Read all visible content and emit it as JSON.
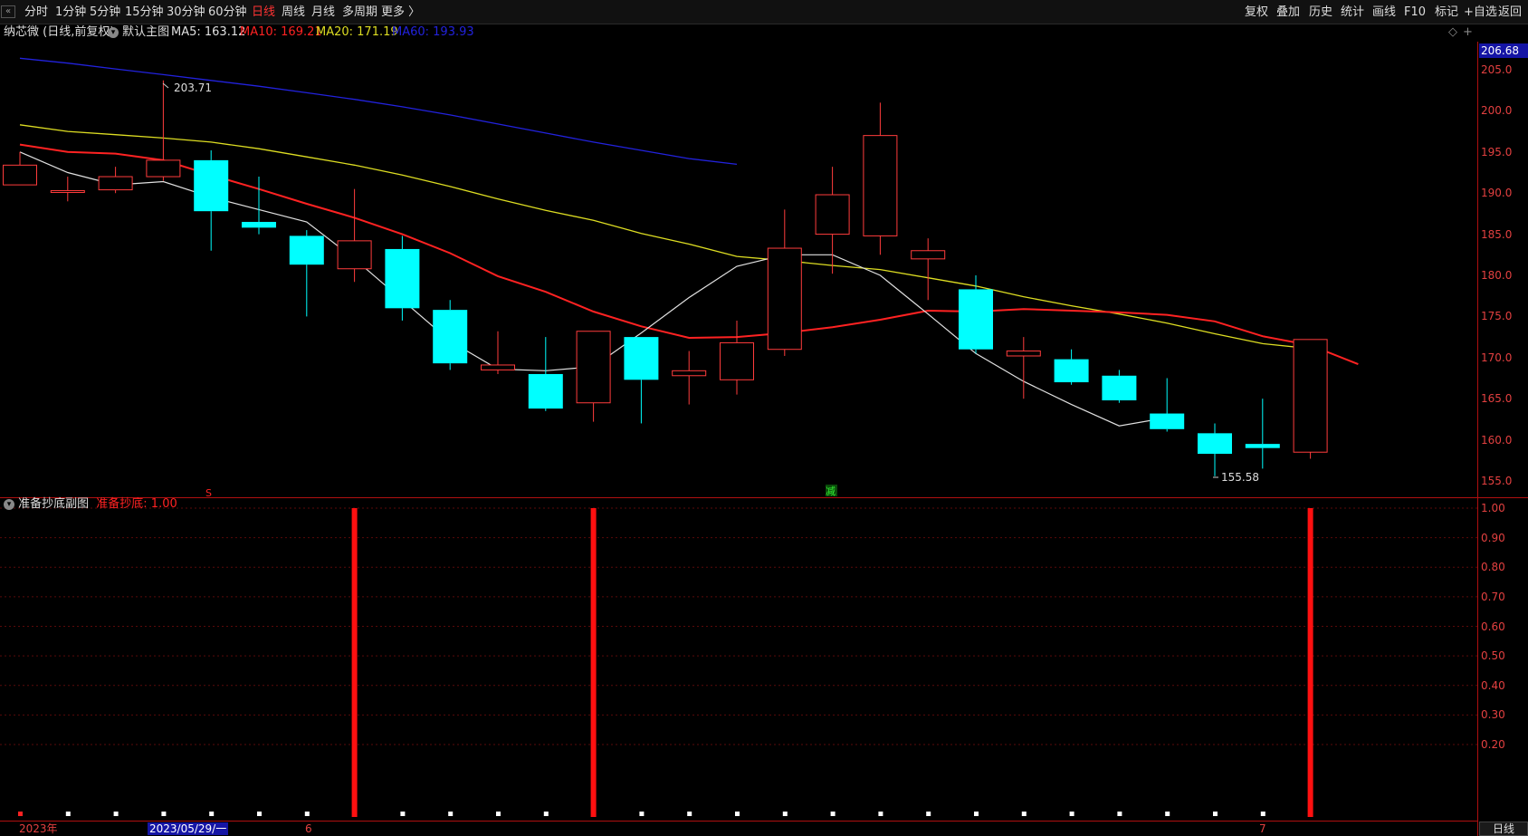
{
  "toolbar": {
    "tabs": [
      "分时",
      "1分钟",
      "5分钟",
      "15分钟",
      "30分钟",
      "60分钟",
      "日线",
      "周线",
      "月线",
      "多周期",
      "更多 〉"
    ],
    "active_tab": "日线",
    "right_buttons": [
      "复权",
      "叠加",
      "历史",
      "统计",
      "画线",
      "F10",
      "标记",
      "+自选",
      "返回"
    ]
  },
  "chart_header": {
    "stock": "纳芯微 (日线,前复权)",
    "template": "默认主图",
    "ma5": "MA5: 163.12",
    "ma10": "MA10: 169.21",
    "ma20": "MA20: 171.19",
    "ma60": "MA60: 193.93",
    "ma_colors": {
      "ma5": "#e0e0e0",
      "ma10": "#ff2222",
      "ma20": "#dddd22",
      "ma60": "#2222dd"
    }
  },
  "price_axis": {
    "last_price": "206.68",
    "ticks": [
      "205.0",
      "200.0",
      "195.0",
      "190.0",
      "185.0",
      "180.0",
      "175.0",
      "170.0",
      "165.0",
      "160.0",
      "155.0"
    ]
  },
  "annotations": {
    "high_label": "203.71",
    "low_label": "155.58",
    "mark_s": "S",
    "mark_jian": "减"
  },
  "sub_chart": {
    "title": "准备抄底副图",
    "value_label": "准备抄底: 1.00",
    "ticks": [
      "1.00",
      "0.90",
      "0.80",
      "0.70",
      "0.60",
      "0.50",
      "0.40",
      "0.30",
      "0.20"
    ]
  },
  "x_axis": {
    "year": "2023年",
    "date": "2023/05/29/一",
    "m6": "6",
    "m7": "7"
  },
  "bottom_tab": "日线",
  "chart_data": {
    "type": "candlestick",
    "price_ylim": [
      154,
      208
    ],
    "candles": [
      {
        "o": 191.0,
        "c": 193.4,
        "h": 195.0,
        "l": 191.0
      },
      {
        "o": 190.2,
        "c": 190.3,
        "h": 192.0,
        "l": 189.0
      },
      {
        "o": 190.4,
        "c": 192.0,
        "h": 193.2,
        "l": 190.0
      },
      {
        "o": 192.0,
        "c": 194.0,
        "h": 203.71,
        "l": 191.5
      },
      {
        "o": 194.0,
        "c": 187.8,
        "h": 195.2,
        "l": 183.0
      },
      {
        "o": 186.5,
        "c": 185.8,
        "h": 192.0,
        "l": 185.0
      },
      {
        "o": 184.8,
        "c": 181.3,
        "h": 185.5,
        "l": 175.0
      },
      {
        "o": 180.8,
        "c": 184.2,
        "h": 190.5,
        "l": 179.2
      },
      {
        "o": 183.2,
        "c": 176.0,
        "h": 184.8,
        "l": 174.5
      },
      {
        "o": 175.8,
        "c": 169.3,
        "h": 177.0,
        "l": 168.5
      },
      {
        "o": 168.5,
        "c": 169.1,
        "h": 173.2,
        "l": 168.0
      },
      {
        "o": 168.0,
        "c": 163.8,
        "h": 172.5,
        "l": 163.5
      },
      {
        "o": 164.5,
        "c": 173.2,
        "h": 173.2,
        "l": 162.2
      },
      {
        "o": 172.5,
        "c": 167.3,
        "h": 172.5,
        "l": 162.0
      },
      {
        "o": 167.8,
        "c": 168.4,
        "h": 170.8,
        "l": 164.3
      },
      {
        "o": 167.3,
        "c": 171.8,
        "h": 174.5,
        "l": 165.5
      },
      {
        "o": 171.0,
        "c": 183.3,
        "h": 188.0,
        "l": 170.2
      },
      {
        "o": 185.0,
        "c": 189.8,
        "h": 193.2,
        "l": 180.2
      },
      {
        "o": 184.8,
        "c": 197.0,
        "h": 201.0,
        "l": 182.5
      },
      {
        "o": 182.0,
        "c": 183.0,
        "h": 184.5,
        "l": 177.0
      },
      {
        "o": 178.3,
        "c": 171.0,
        "h": 180.0,
        "l": 170.5
      },
      {
        "o": 170.2,
        "c": 170.8,
        "h": 172.5,
        "l": 165.0
      },
      {
        "o": 169.8,
        "c": 167.0,
        "h": 171.0,
        "l": 166.7
      },
      {
        "o": 167.8,
        "c": 164.8,
        "h": 168.5,
        "l": 164.5
      },
      {
        "o": 163.2,
        "c": 161.3,
        "h": 167.5,
        "l": 161.0
      },
      {
        "o": 160.8,
        "c": 158.3,
        "h": 162.0,
        "l": 155.58
      },
      {
        "o": 159.5,
        "c": 159.0,
        "h": 165.0,
        "l": 156.5
      },
      {
        "o": 158.5,
        "c": 172.2,
        "h": 172.2,
        "l": 157.7
      }
    ],
    "ma5": [
      195.0,
      192.5,
      191.0,
      191.4,
      189.5,
      188.0,
      186.5,
      182.0,
      177.0,
      172.0,
      168.6,
      168.4,
      168.9,
      173.0,
      177.3,
      181.1,
      182.5,
      182.5,
      180.0,
      175.3,
      170.5,
      167.1,
      164.3,
      161.7,
      162.7
    ],
    "ma10": [
      195.9,
      195.0,
      194.8,
      194.0,
      192.2,
      190.5,
      188.7,
      187.0,
      185.0,
      182.7,
      179.9,
      178.0,
      175.6,
      173.8,
      172.4,
      172.5,
      173.0,
      173.7,
      174.6,
      175.7,
      175.6,
      175.9,
      175.7,
      175.5,
      175.2,
      174.4,
      172.6,
      171.5,
      169.2
    ],
    "ma20": [
      198.3,
      197.5,
      197.1,
      196.7,
      196.2,
      195.4,
      194.4,
      193.4,
      192.2,
      190.8,
      189.3,
      187.9,
      186.7,
      185.1,
      183.8,
      182.3,
      181.8,
      181.2,
      180.7,
      179.7,
      178.7,
      177.4,
      176.3,
      175.3,
      174.2,
      172.9,
      171.7,
      171.1
    ],
    "ma60": [
      206.4,
      205.8,
      205.1,
      204.4,
      203.7,
      203.0,
      202.2,
      201.4,
      200.5,
      199.5,
      198.4,
      197.3,
      196.2,
      195.2,
      194.2,
      193.5
    ],
    "ma60_x_start": 0,
    "indicator": {
      "name": "准备抄底",
      "ylim": [
        0.1,
        1.0
      ],
      "signals": [
        0,
        0,
        0,
        0,
        0,
        0,
        0,
        1,
        0,
        0,
        0,
        0,
        1,
        0,
        0,
        0,
        0,
        0,
        0,
        0,
        0,
        0,
        0,
        0,
        0,
        0,
        0,
        1
      ]
    }
  }
}
